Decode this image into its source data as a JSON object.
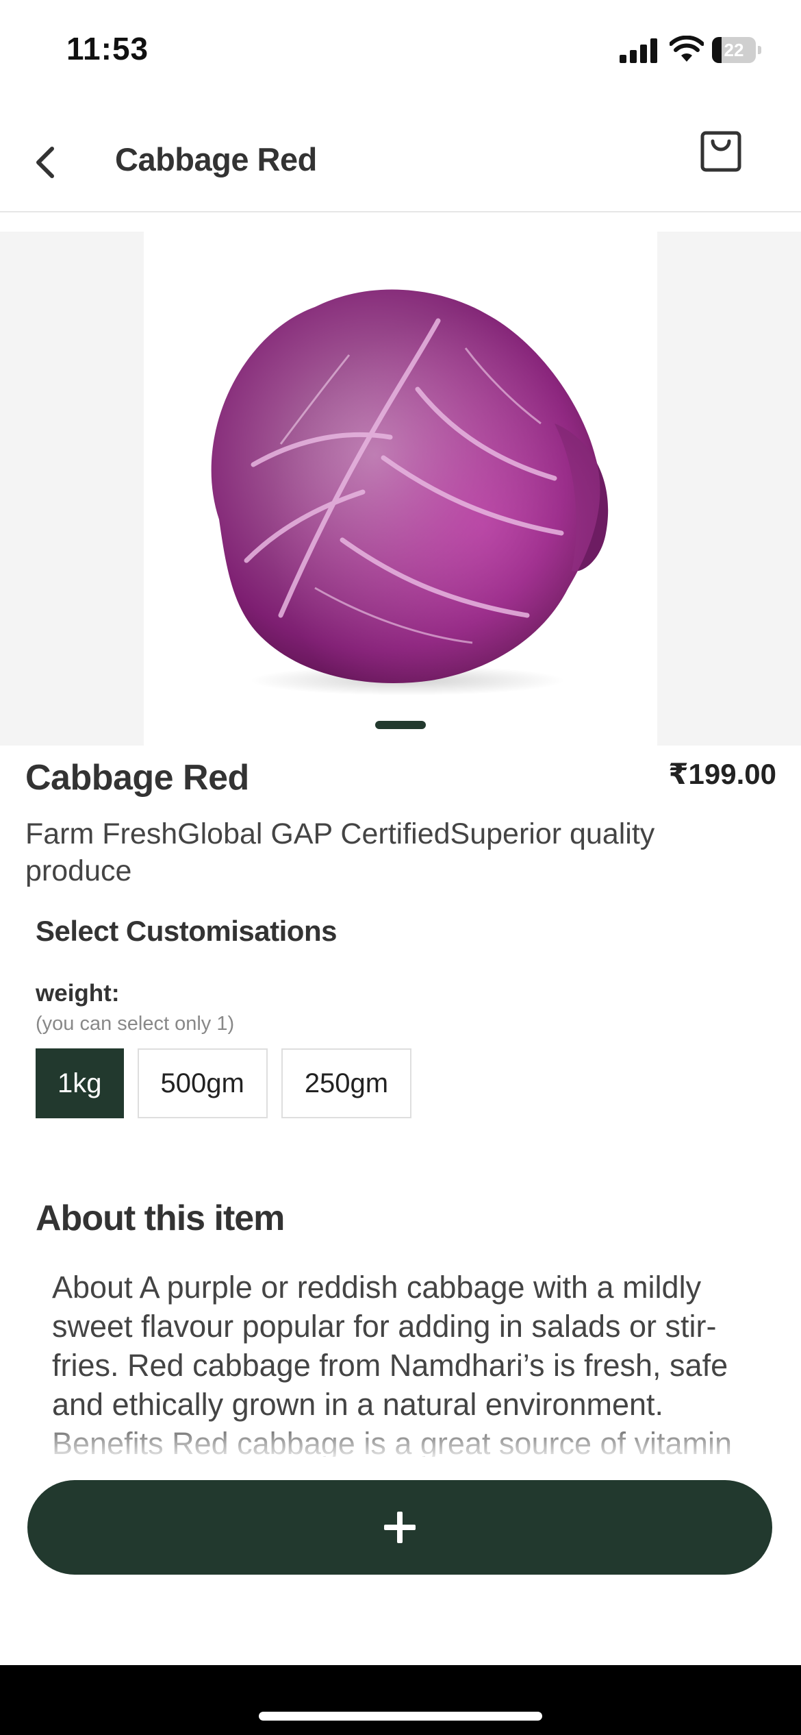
{
  "status_bar": {
    "time": "11:53",
    "battery_level": "22",
    "battery_fraction": 0.22
  },
  "header": {
    "title": "Cabbage Red",
    "back_icon": "chevron-left-icon",
    "cart_icon": "shopping-bag-icon"
  },
  "carousel": {
    "image_subject": "red cabbage",
    "active_index": 0
  },
  "product": {
    "name": "Cabbage Red",
    "price": "₹199.00",
    "tagline": "Farm FreshGlobal GAP CertifiedSuperior quality produce"
  },
  "customisations": {
    "title": "Select Customisations",
    "group_label": "weight:",
    "hint": "(you can select only 1)",
    "options": [
      {
        "label": "1kg",
        "selected": true
      },
      {
        "label": "500gm",
        "selected": false
      },
      {
        "label": "250gm",
        "selected": false
      }
    ]
  },
  "about": {
    "title": "About this item",
    "text": "About A purple or reddish cabbage with a mildly sweet flavour popular for adding in salads or stir-fries. Red cabbage from Namdhari’s is fresh, safe and ethically grown in a natural environment. Benefits Red cabbage is a great source of vitamin"
  },
  "action": {
    "add_icon": "plus-icon"
  },
  "colors": {
    "brand_dark_green": "#22392e",
    "text_primary": "#333333",
    "text_muted": "#888888",
    "cabbage_purple": "#9b2c83"
  }
}
